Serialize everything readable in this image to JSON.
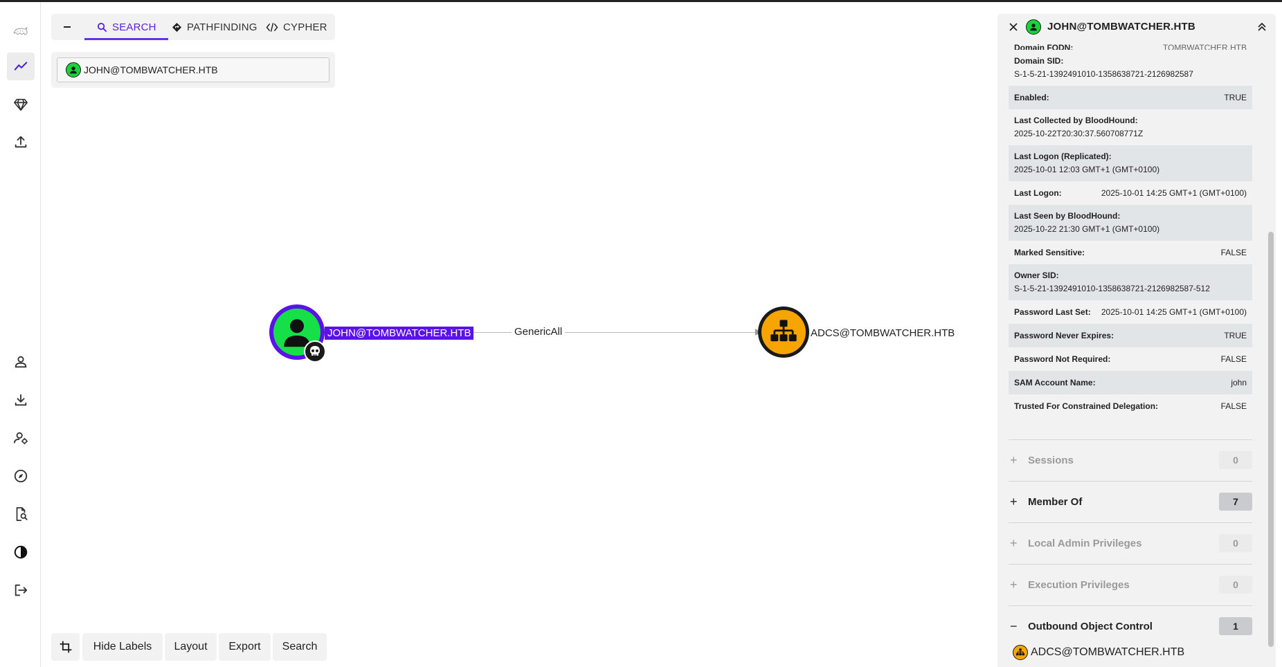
{
  "colors": {
    "accent": "#6a2ee8",
    "user_node": "#15e048",
    "group_node": "#f6a500"
  },
  "nav": {
    "items": [
      {
        "icon": "logo-icon"
      },
      {
        "icon": "explore-icon",
        "active": true
      },
      {
        "icon": "gem-icon"
      },
      {
        "icon": "upload-icon"
      },
      {
        "icon": "user-icon"
      },
      {
        "icon": "download-icon"
      },
      {
        "icon": "user-settings-icon"
      },
      {
        "icon": "compass-icon"
      },
      {
        "icon": "doc-search-icon"
      },
      {
        "icon": "contrast-icon"
      },
      {
        "icon": "logout-icon"
      }
    ]
  },
  "search": {
    "tabs": [
      {
        "label": "SEARCH",
        "icon": "search-icon",
        "active": true
      },
      {
        "label": "PATHFINDING",
        "icon": "diamond-icon"
      },
      {
        "label": "CYPHER",
        "icon": "code-icon"
      }
    ],
    "value": "JOHN@TOMBWATCHER.HTB"
  },
  "graph": {
    "source_node": "JOHN@TOMBWATCHER.HTB",
    "edge_label": "GenericAll",
    "target_node": "ADCS@TOMBWATCHER.HTB"
  },
  "toolbar": {
    "hide_labels": "Hide Labels",
    "layout": "Layout",
    "export": "Export",
    "search": "Search"
  },
  "panel": {
    "title": "JOHN@TOMBWATCHER.HTB",
    "partial_top": {
      "key": "Domain FQDN:",
      "value": "TOMBWATCHER.HTB"
    },
    "properties": [
      {
        "key": "Domain SID:",
        "value": "S-1-5-21-1392491010-1358638721-2126982587",
        "layout": "two",
        "shade": false
      },
      {
        "key": "Enabled:",
        "value": "TRUE",
        "layout": "one",
        "shade": true
      },
      {
        "key": "Last Collected by BloodHound:",
        "value": "2025-10-22T20:30:37.560708771Z",
        "layout": "two",
        "shade": false
      },
      {
        "key": "Last Logon (Replicated):",
        "value": "2025-10-01 12:03 GMT+1 (GMT+0100)",
        "layout": "two",
        "shade": true
      },
      {
        "key": "Last Logon:",
        "value": "2025-10-01 14:25 GMT+1 (GMT+0100)",
        "layout": "one",
        "shade": false
      },
      {
        "key": "Last Seen by BloodHound:",
        "value": "2025-10-22 21:30 GMT+1 (GMT+0100)",
        "layout": "two",
        "shade": true
      },
      {
        "key": "Marked Sensitive:",
        "value": "FALSE",
        "layout": "one",
        "shade": false
      },
      {
        "key": "Owner SID:",
        "value": "S-1-5-21-1392491010-1358638721-2126982587-512",
        "layout": "two",
        "shade": true
      },
      {
        "key": "Password Last Set:",
        "value": "2025-10-01 14:25 GMT+1 (GMT+0100)",
        "layout": "one",
        "shade": false
      },
      {
        "key": "Password Never Expires:",
        "value": "TRUE",
        "layout": "one",
        "shade": true
      },
      {
        "key": "Password Not Required:",
        "value": "FALSE",
        "layout": "one",
        "shade": false
      },
      {
        "key": "SAM Account Name:",
        "value": "john",
        "layout": "one",
        "shade": true
      },
      {
        "key": "Trusted For Constrained Delegation:",
        "value": "FALSE",
        "layout": "one",
        "shade": false
      }
    ],
    "sections": [
      {
        "label": "Sessions",
        "count": "0",
        "sign": "+",
        "dim": true
      },
      {
        "label": "Member Of",
        "count": "7",
        "sign": "+",
        "dim": false
      },
      {
        "label": "Local Admin Privileges",
        "count": "0",
        "sign": "+",
        "dim": true
      },
      {
        "label": "Execution Privileges",
        "count": "0",
        "sign": "+",
        "dim": true
      },
      {
        "label": "Outbound Object Control",
        "count": "1",
        "sign": "−",
        "dim": false
      }
    ],
    "outbound_item": "ADCS@TOMBWATCHER.HTB"
  }
}
